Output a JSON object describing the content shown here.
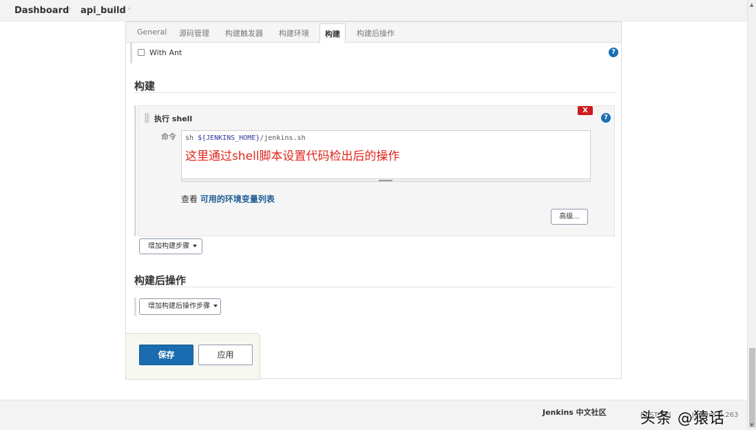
{
  "breadcrumb": {
    "items": [
      "Dashboard",
      "api_build"
    ],
    "separator": "›"
  },
  "tabs": [
    "General",
    "源码管理",
    "构建触发器",
    "构建环境",
    "构建",
    "构建后操作"
  ],
  "active_tab": "构建",
  "with_ant": {
    "label": "With Ant",
    "checked": false
  },
  "help_icon": "?",
  "build_section": {
    "title": "构建",
    "step": {
      "title": "执行 shell",
      "delete_label": "X",
      "command_label": "命令",
      "command_prefix": "sh ",
      "command_var": "${JENKINS_HOME}",
      "command_suffix": "/jenkins.sh",
      "annotation": "这里通过shell脚本设置代码检出后的操作",
      "env_prefix": "查看 ",
      "env_link": "可用的环境变量列表",
      "advanced_button": "高级..."
    },
    "add_step_button": "增加构建步骤"
  },
  "post_build_section": {
    "title": "构建后操作",
    "add_step_button": "增加构建后操作步骤"
  },
  "actions": {
    "save": "保存",
    "apply": "应用"
  },
  "footer": {
    "community": "Jenkins 中文社区",
    "rest_api": "REST API",
    "version": "Jenkins 2.263"
  },
  "watermark": "头条 @猿话",
  "colors": {
    "primary": "#1b6bb0",
    "danger": "#cc1b1b",
    "annotation": "#e0261e",
    "link": "#1e5c94"
  }
}
